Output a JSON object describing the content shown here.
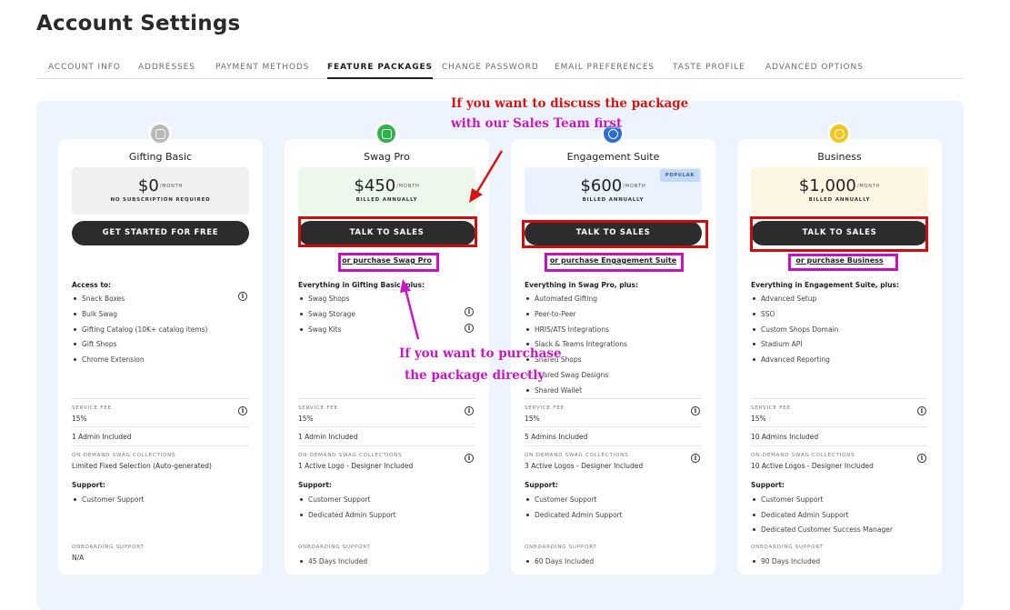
{
  "page_title": "Account Settings",
  "tabs": [
    {
      "label": "ACCOUNT INFO"
    },
    {
      "label": "ADDRESSES"
    },
    {
      "label": "PAYMENT METHODS"
    },
    {
      "label": "FEATURE PACKAGES"
    },
    {
      "label": "CHANGE PASSWORD"
    },
    {
      "label": "EMAIL PREFERENCES"
    },
    {
      "label": "TASTE PROFILE"
    },
    {
      "label": "ADVANCED OPTIONS"
    }
  ],
  "active_tab": "FEATURE PACKAGES",
  "plans": [
    {
      "name": "Gifting Basic",
      "icon": "gift-icon",
      "icon_color": "#b9b9b9",
      "price_bg": "#f0f0f1",
      "price": "$0",
      "per": "/MONTH",
      "price_note": "NO SUBSCRIPTION REQUIRED",
      "cta": "GET STARTED FOR FREE",
      "features_title": "Access to:",
      "features": [
        "Snack Boxes",
        "Bulk Swag",
        "Gifting Catalog (10K+ catalog items)",
        "Gift Shops",
        "Chrome Extension"
      ],
      "service_fee_label": "SERVICE FEE",
      "service_fee": "15%",
      "admins": "1 Admin Included",
      "collections_label": "ON-DEMAND SWAG COLLECTIONS",
      "collections": "Limited Fixed Selection (Auto-generated)",
      "support_title": "Support:",
      "support": [
        "Customer Support"
      ],
      "onboarding_label": "ONBOARDING SUPPORT",
      "onboarding": "N/A"
    },
    {
      "name": "Swag Pro",
      "icon": "tshirt-icon",
      "icon_color": "#2fb34a",
      "price_bg": "#ecf8ec",
      "price": "$450",
      "per": "/MONTH",
      "price_note": "BILLED ANNUALLY",
      "cta": "TALK TO SALES",
      "purchase_link": "or purchase Swag Pro",
      "features_title": "Everything in Gifting Basic, plus:",
      "features": [
        "Swag Shops",
        "Swag Storage",
        "Swag Kits"
      ],
      "service_fee_label": "SERVICE FEE",
      "service_fee": "15%",
      "admins": "1 Admin Included",
      "collections_label": "ON-DEMAND SWAG COLLECTIONS",
      "collections": "1 Active Logo - Designer Included",
      "support_title": "Support:",
      "support": [
        "Customer Support",
        "Dedicated Admin Support"
      ],
      "onboarding_label": "ONBOARDING SUPPORT",
      "onboarding": "45 Days Included"
    },
    {
      "name": "Engagement Suite",
      "icon": "rocket-icon",
      "icon_color": "#2b6fd6",
      "price_bg": "#eaf2fd",
      "price": "$600",
      "per": "/MONTH",
      "price_note": "BILLED ANNUALLY",
      "badge": "POPULAR",
      "cta": "TALK TO SALES",
      "purchase_link": "or purchase Engagement Suite",
      "features_title": "Everything in Swag Pro, plus:",
      "features": [
        "Automated Gifting",
        "Peer-to-Peer",
        "HRIS/ATS Integrations",
        "Slack & Teams Integrations",
        "Shared Shops",
        "Shared Swag Designs",
        "Shared Wallet"
      ],
      "service_fee_label": "SERVICE FEE",
      "service_fee": "15%",
      "admins": "5 Admins Included",
      "collections_label": "ON-DEMAND SWAG COLLECTIONS",
      "collections": "3 Active Logos - Designer Included",
      "support_title": "Support:",
      "support": [
        "Customer Support",
        "Dedicated Admin Support"
      ],
      "onboarding_label": "ONBOARDING SUPPORT",
      "onboarding": "60 Days Included"
    },
    {
      "name": "Business",
      "icon": "briefcase-icon",
      "icon_color": "#f3c51f",
      "price_bg": "#fdf6e3",
      "price": "$1,000",
      "per": "/MONTH",
      "price_note": "BILLED ANNUALLY",
      "cta": "TALK TO SALES",
      "purchase_link": "or purchase Business",
      "features_title": "Everything in Engagement Suite, plus:",
      "features": [
        "Advanced Setup",
        "SSO",
        "Custom Shops Domain",
        "Stadium API",
        "Advanced Reporting"
      ],
      "service_fee_label": "SERVICE FEE",
      "service_fee": "15%",
      "admins": "10 Admins Included",
      "collections_label": "ON-DEMAND SWAG COLLECTIONS",
      "collections": "10 Active Logos - Designer Included",
      "support_title": "Support:",
      "support": [
        "Customer Support",
        "Dedicated Admin Support",
        "Dedicated Customer Success Manager"
      ],
      "onboarding_label": "ONBOARDING SUPPORT",
      "onboarding": "90 Days Included"
    }
  ],
  "annotations": {
    "sales": [
      "If you want to discuss the package",
      "with our Sales Team first"
    ],
    "purchase": [
      "If you want to purchase",
      "the package directly"
    ],
    "colors": {
      "red": "#d10b0b",
      "magenta": "#c511bf"
    }
  }
}
